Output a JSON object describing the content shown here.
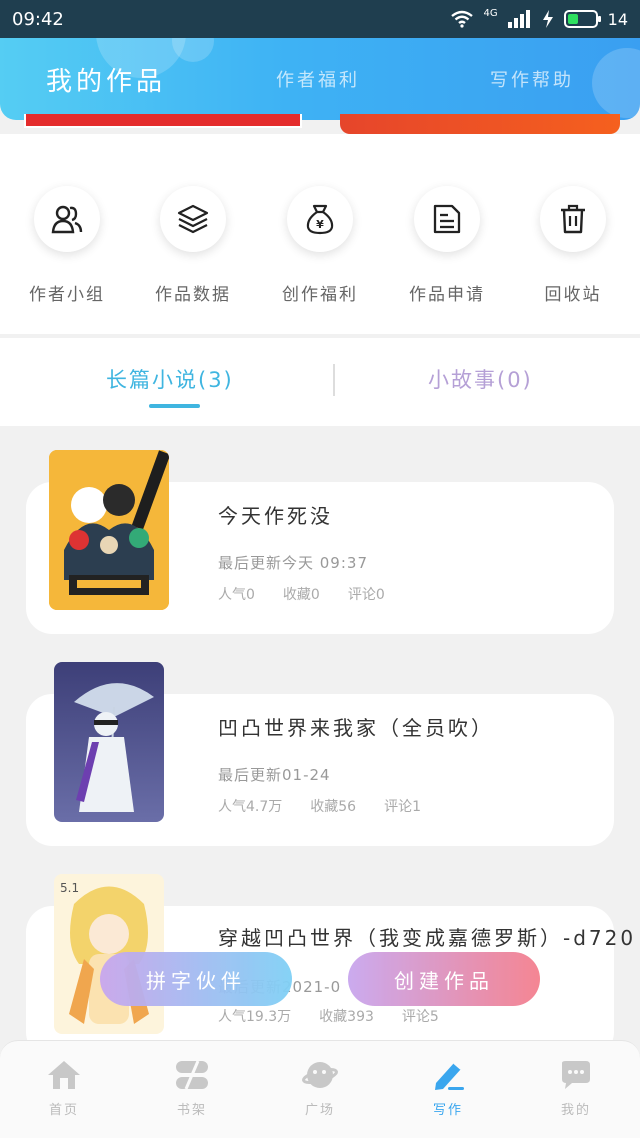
{
  "status_bar": {
    "time": "09:42",
    "network": "4G",
    "battery": "14"
  },
  "header": {
    "tabs": [
      {
        "label": "我的作品",
        "active": true
      },
      {
        "label": "作者福利",
        "active": false
      },
      {
        "label": "写作帮助",
        "active": false
      }
    ]
  },
  "quick_actions": [
    {
      "label": "作者小组",
      "icon": "group-icon"
    },
    {
      "label": "作品数据",
      "icon": "layers-icon"
    },
    {
      "label": "创作福利",
      "icon": "money-bag-icon"
    },
    {
      "label": "作品申请",
      "icon": "document-icon"
    },
    {
      "label": "回收站",
      "icon": "trash-icon"
    }
  ],
  "works_tabs": [
    {
      "label": "长篇小说(3)",
      "active": true
    },
    {
      "label": "小故事(0)",
      "active": false
    }
  ],
  "books": [
    {
      "title": "今天作死没",
      "updated": "最后更新今天 09:37",
      "popularity": "人气0",
      "favorites": "收藏0",
      "comments": "评论0",
      "cover_color": "#f5b73a"
    },
    {
      "title": "凹凸世界来我家（全员吹）",
      "updated": "最后更新01-24",
      "popularity": "人气4.7万",
      "favorites": "收藏56",
      "comments": "评论1",
      "cover_color": "#4b4c84"
    },
    {
      "title": "穿越凹凸世界（我变成嘉德罗斯）-d720",
      "updated": "最后更新2021-0",
      "popularity": "人气19.3万",
      "favorites": "收藏393",
      "comments": "评论5",
      "cover_color": "#f8e7b0"
    }
  ],
  "floating_buttons": {
    "partner": "拼字伙伴",
    "create": "创建作品"
  },
  "bottom_nav": [
    {
      "label": "首页",
      "icon": "home-icon",
      "active": false
    },
    {
      "label": "书架",
      "icon": "bookshelf-icon",
      "active": false
    },
    {
      "label": "广场",
      "icon": "planet-icon",
      "active": false
    },
    {
      "label": "写作",
      "icon": "pen-icon",
      "active": true
    },
    {
      "label": "我的",
      "icon": "chat-bubble-icon",
      "active": false
    }
  ],
  "colors": {
    "accent": "#3fb5e0",
    "header_gradient_start": "#55cdf3",
    "header_gradient_end": "#3a9ff1",
    "inactive_tab": "#b5a0d6"
  }
}
